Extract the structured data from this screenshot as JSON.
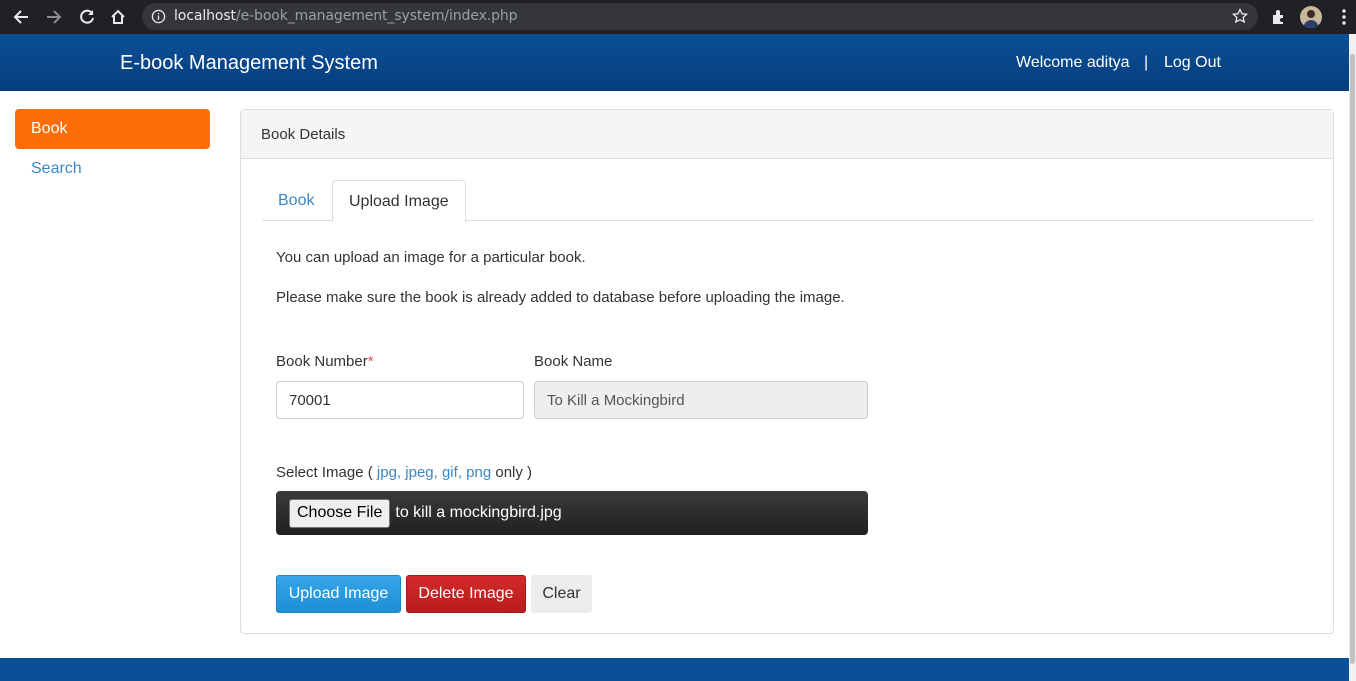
{
  "browser": {
    "url_host": "localhost",
    "url_path": "/e-book_management_system/index.php"
  },
  "header": {
    "brand": "E-book Management System",
    "welcome": "Welcome aditya",
    "separator": "|",
    "logout": "Log Out"
  },
  "sidebar": {
    "items": [
      {
        "label": "Book",
        "active": true
      },
      {
        "label": "Search",
        "active": false
      }
    ]
  },
  "panel": {
    "title": "Book Details",
    "tabs": [
      {
        "label": "Book",
        "active": false
      },
      {
        "label": "Upload Image",
        "active": true
      }
    ],
    "info_lines": [
      "You can upload an image for a particular book.",
      "Please make sure the book is already added to database before uploading the image."
    ],
    "book_number": {
      "label": "Book Number",
      "required_mark": "*",
      "value": "70001"
    },
    "book_name": {
      "label": "Book Name",
      "value": "To Kill a Mockingbird"
    },
    "select_image": {
      "prefix": "Select Image ( ",
      "extensions": [
        "jpg",
        "jpeg",
        "gif",
        "png"
      ],
      "suffix": " only )",
      "choose_label": "Choose File",
      "file_name": "to kill a mockingbird.jpg"
    },
    "buttons": {
      "upload": "Upload Image",
      "delete": "Delete Image",
      "clear": "Clear"
    }
  },
  "colors": {
    "header_blue": "#0b4f97",
    "sidebar_active": "#ff6c0a",
    "link_blue": "#3a87c4",
    "upload_btn": "#1f8fd6",
    "delete_btn": "#b81c1c"
  }
}
